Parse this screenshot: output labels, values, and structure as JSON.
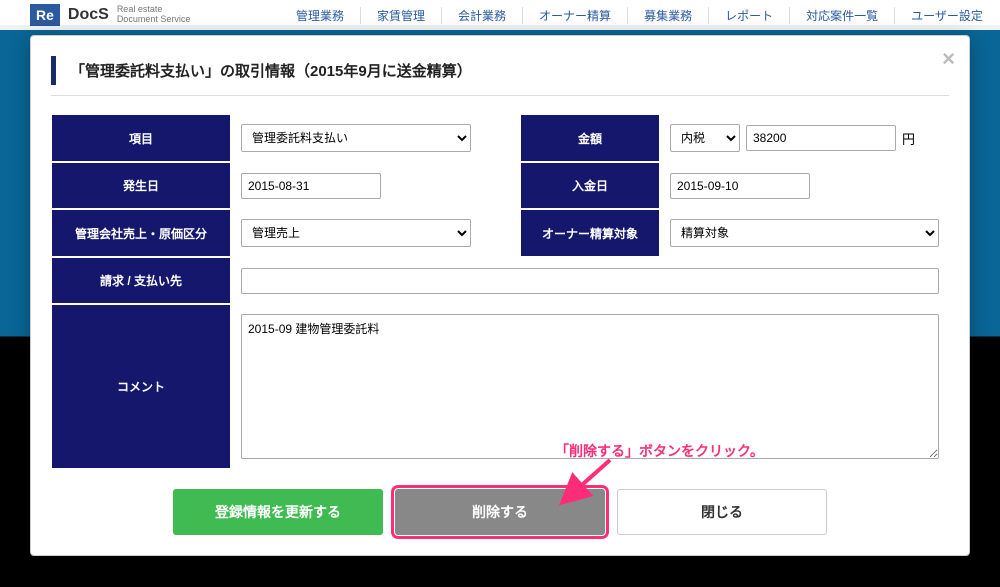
{
  "header": {
    "logo_prefix": "Re",
    "logo_main": "DocS",
    "logo_sub1": "Real estate",
    "logo_sub2": "Document Service"
  },
  "nav": {
    "items": [
      "管理業務",
      "家賃管理",
      "会計業務",
      "オーナー精算",
      "募集業務",
      "レポート",
      "対応案件一覧",
      "ユーザー設定"
    ]
  },
  "modal": {
    "title": "「管理委託料支払い」の取引情報（2015年9月に送金精算）",
    "labels": {
      "item": "項目",
      "amount": "金額",
      "occur_date": "発生日",
      "deposit_date": "入金日",
      "category": "管理会社売上・原価区分",
      "owner_settle": "オーナー精算対象",
      "payee": "請求 / 支払い先",
      "comment": "コメント"
    },
    "values": {
      "item_select": "管理委託料支払い",
      "tax_select": "内税",
      "amount": "38200",
      "currency": "円",
      "occur_date": "2015-08-31",
      "deposit_date": "2015-09-10",
      "category_select": "管理売上",
      "owner_settle_select": "精算対象",
      "payee": "",
      "comment": "2015-09 建物管理委託料"
    },
    "buttons": {
      "update": "登録情報を更新する",
      "delete": "削除する",
      "close": "閉じる"
    }
  },
  "annotation": {
    "text": "「削除する」ボタンをクリック。"
  }
}
